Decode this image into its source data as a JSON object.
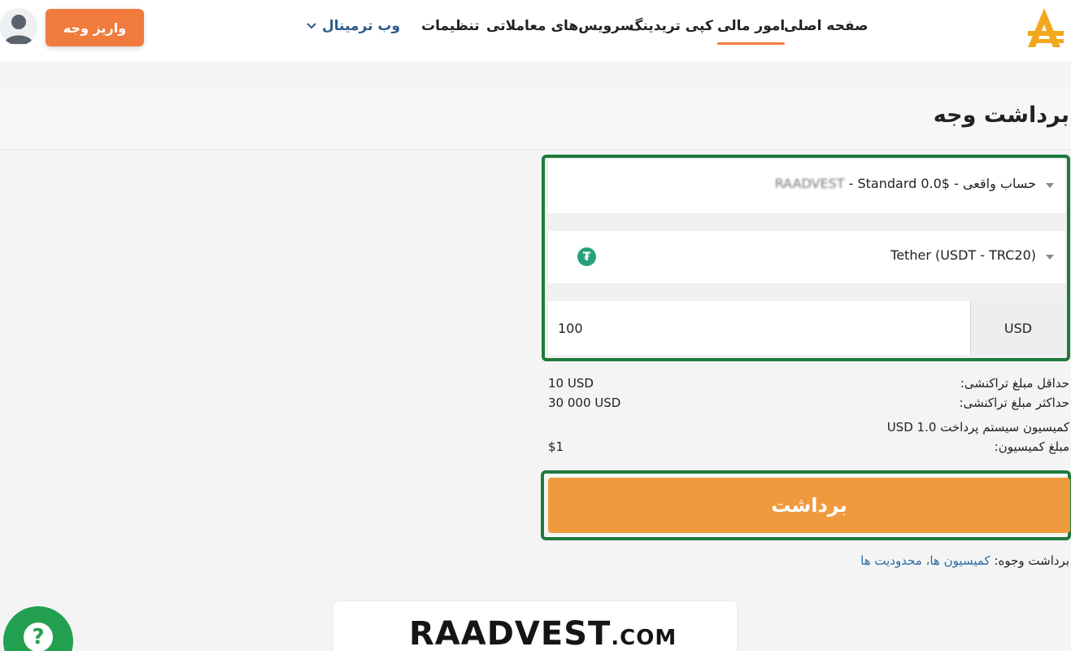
{
  "header": {
    "nav": {
      "home": "صفحه اصلی",
      "finance": "امور مالی",
      "copy_trading": "کپی تریدینگ",
      "trading_services": "سرویس‌های معاملاتی",
      "settings": "تنظیمات",
      "web_terminal": "وب ترمینال"
    },
    "deposit_label": "واریز وجه"
  },
  "page": {
    "title": "برداشت وجه"
  },
  "form": {
    "account": {
      "prefix": "حساب واقعی -",
      "blurred": "RAADVEST",
      "suffix": "- Standard 0.0$"
    },
    "method": {
      "label": "Tether (USDT - TRC20)",
      "icon": "tether-icon"
    },
    "amount": {
      "value": "100",
      "currency": "USD"
    }
  },
  "info": {
    "min_label": "حداقل مبلغ تراکنشی:",
    "min_value": "10 USD",
    "max_label": "حداکثر مبلغ تراکنشی:",
    "max_value": "30 000 USD",
    "commission_system": "کمیسیون سیستم پرداخت USD 1.0",
    "commission_label": "مبلغ کمیسیون:",
    "commission_value": "$1"
  },
  "withdraw_label": "برداشت",
  "footer_note": {
    "prefix": "برداشت وجوه:",
    "link": "کمیسیون ها، محدودیت ها"
  },
  "watermark": {
    "brand": "RAADVEST",
    "tld": ".COM"
  },
  "help": {
    "symbol": "?"
  },
  "colors": {
    "accent_orange": "#f07b3c",
    "highlight_green": "#1e7a3c",
    "link_blue": "#2b6ca3"
  }
}
